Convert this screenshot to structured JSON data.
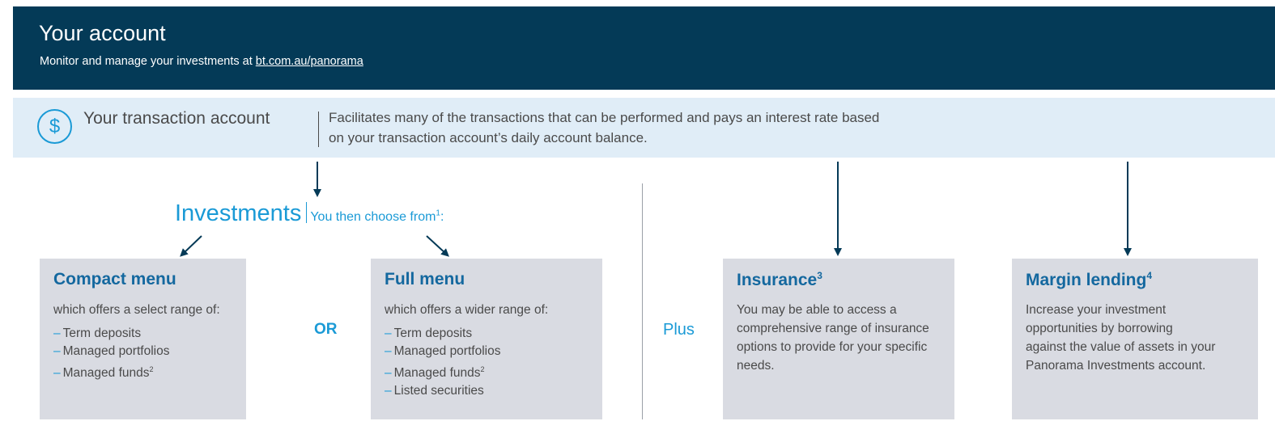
{
  "header": {
    "title": "Your account",
    "subtitle_prefix": "Monitor and manage your investments at ",
    "link": "bt.com.au/panorama"
  },
  "transaction": {
    "icon_glyph": "$",
    "title": "Your transaction account",
    "description": "Facilitates many of the transactions that can be performed and pays an interest rate based on your transaction account’s daily account balance."
  },
  "investments": {
    "title": "Investments",
    "subtitle": "You then choose from",
    "subtitle_note": "1",
    "subtitle_suffix": ":"
  },
  "compact": {
    "title": "Compact menu",
    "intro": "which offers a select range of:",
    "items": [
      "Term deposits",
      "Managed portfolios",
      "Managed funds"
    ],
    "item3_note": "2"
  },
  "or_label": "OR",
  "full": {
    "title": "Full menu",
    "intro": "which offers a wider range of:",
    "items": [
      "Term deposits",
      "Managed portfolios",
      "Managed funds",
      "Listed securities"
    ],
    "item3_note": "2"
  },
  "plus_label": "Plus",
  "insurance": {
    "title": "Insurance",
    "note": "3",
    "text": "You may be able to access a comprehensive range of insurance options to provide for your specific needs."
  },
  "margin": {
    "title": "Margin lending",
    "note": "4",
    "text": "Increase your investment opportunities by borrowing against the value of assets in your Panorama Investments account."
  },
  "dash": "–",
  "colors": {
    "header_bg": "#043a57",
    "band_bg": "#e0edf7",
    "accent": "#1a9ad6",
    "box_title": "#14689f",
    "box_bg": "#d9dbe2"
  }
}
